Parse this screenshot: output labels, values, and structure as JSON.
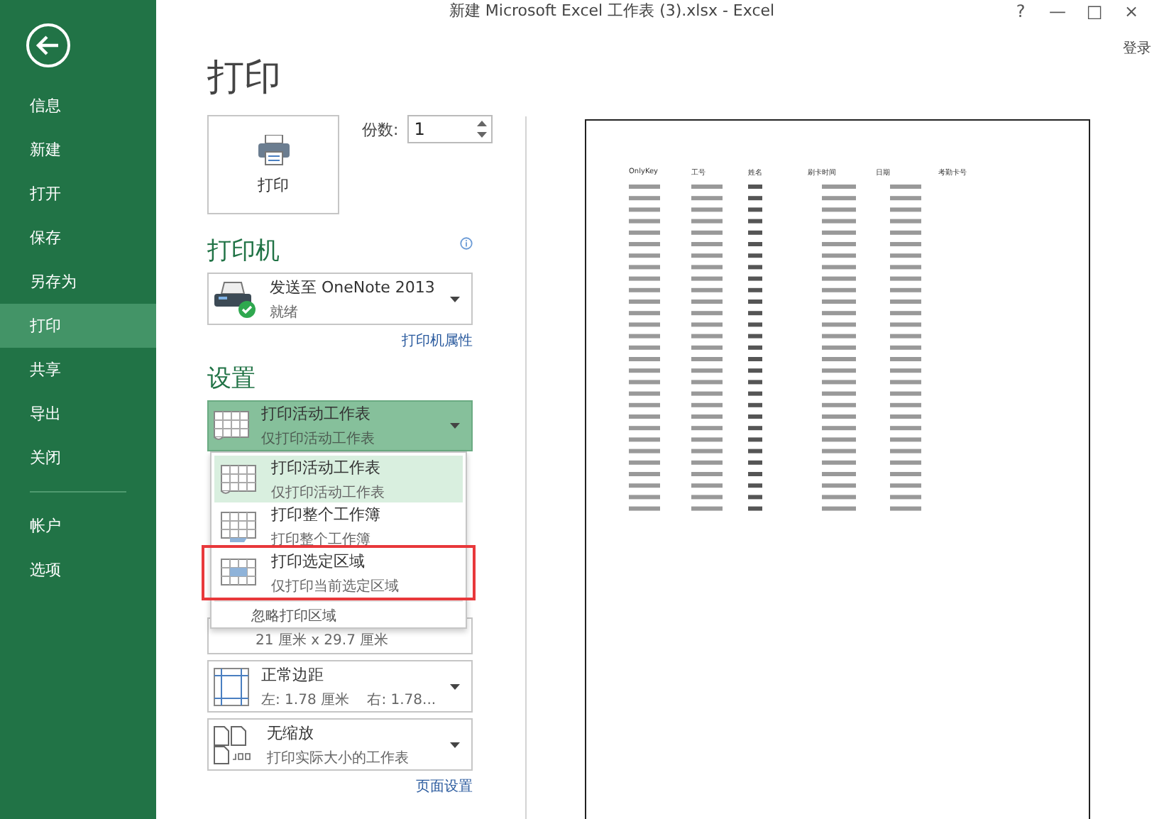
{
  "window": {
    "title": "新建 Microsoft Excel 工作表 (3).xlsx - Excel",
    "controls": [
      "?",
      "—",
      "□",
      "×"
    ],
    "sign_in": "登录"
  },
  "sidebar": {
    "items": [
      {
        "label": "信息",
        "selected": false
      },
      {
        "label": "新建",
        "selected": false
      },
      {
        "label": "打开",
        "selected": false
      },
      {
        "label": "保存",
        "selected": false
      },
      {
        "label": "另存为",
        "selected": false
      },
      {
        "label": "打印",
        "selected": true
      },
      {
        "label": "共享",
        "selected": false
      },
      {
        "label": "导出",
        "selected": false
      },
      {
        "label": "关闭",
        "selected": false
      }
    ],
    "bottom_items": [
      {
        "label": "帐户",
        "selected": false
      },
      {
        "label": "选项",
        "selected": false
      }
    ]
  },
  "page_title": "打印",
  "print_button": {
    "label": "打印"
  },
  "copies": {
    "label": "份数:",
    "value": "1"
  },
  "printer": {
    "heading": "打印机",
    "name": "发送至 OneNote 2013",
    "status": "就绪",
    "properties_link": "打印机属性"
  },
  "settings": {
    "heading": "设置",
    "current": {
      "kind": "sheet",
      "title": "打印活动工作表",
      "subtitle": "仅打印活动工作表"
    },
    "dropdown": {
      "options": [
        {
          "kind": "sheet",
          "title": "打印活动工作表",
          "subtitle": "仅打印活动工作表",
          "selected": true,
          "annotated": false
        },
        {
          "kind": "workbook",
          "title": "打印整个工作簿",
          "subtitle": "打印整个工作簿",
          "selected": false,
          "annotated": false
        },
        {
          "kind": "selection",
          "title": "打印选定区域",
          "subtitle": "仅打印当前选定区域",
          "selected": false,
          "annotated": true
        }
      ],
      "footer": "忽略打印区域"
    },
    "items": [
      {
        "kind": "paper",
        "subtitle": "21 厘米 x 29.7 厘米"
      },
      {
        "kind": "margins",
        "title": "正常边距",
        "subtitle": "左: 1.78 厘米    右: 1.78..."
      },
      {
        "kind": "scaling",
        "title": "无缩放",
        "subtitle": "打印实际大小的工作表"
      }
    ],
    "page_setup_link": "页面设置"
  },
  "preview": {
    "columns": [
      "OnlyKey",
      "工号",
      "姓名",
      "刷卡时间",
      "日期",
      "考勤卡号"
    ]
  }
}
